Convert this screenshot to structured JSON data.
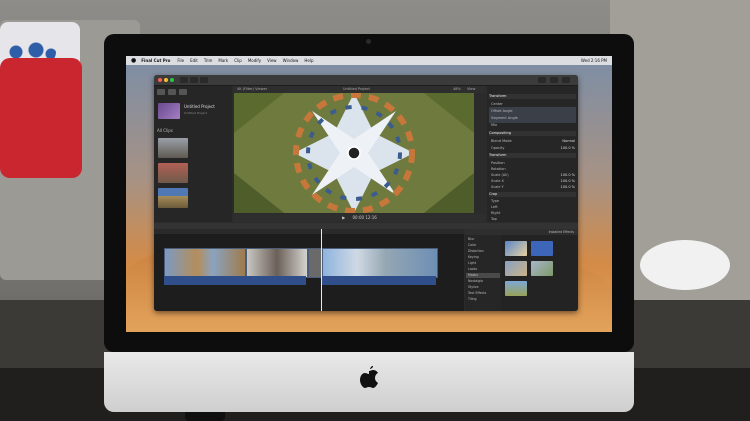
{
  "menubar": {
    "app_name": "Final Cut Pro",
    "items": [
      "File",
      "Edit",
      "Trim",
      "Mark",
      "Clip",
      "Modify",
      "View",
      "Window",
      "Help"
    ],
    "clock": "Wed 2:16 PM"
  },
  "window": {
    "viewer_title": "4K (Filter) Viewer",
    "viewer_clip": "Untitled Project",
    "zoom": "48%",
    "view_menu": "View",
    "timecode": "00:00 12:16"
  },
  "browser": {
    "library_name": "Untitled Project",
    "library_note": "Untitled Project",
    "event_label": "All Clips",
    "thumbs": [
      "",
      "",
      ""
    ]
  },
  "inspector": {
    "sections": [
      "Transform",
      "Compositing",
      "Transform",
      "Crop"
    ],
    "rows": [
      {
        "label": "Center",
        "val": ""
      },
      {
        "label": "Offset Angle",
        "val": ""
      },
      {
        "label": "Segment Angle",
        "val": ""
      },
      {
        "label": "Mix",
        "val": ""
      },
      {
        "label": "Blend Mode",
        "val": "Normal"
      },
      {
        "label": "Opacity",
        "val": "100.0 %"
      },
      {
        "label": "Position",
        "val": ""
      },
      {
        "label": "Rotation",
        "val": ""
      },
      {
        "label": "Scale (All)",
        "val": "100.0 %"
      },
      {
        "label": "Scale X",
        "val": "100.0 %"
      },
      {
        "label": "Scale Y",
        "val": "100.0 %"
      },
      {
        "label": "Anchor",
        "val": ""
      },
      {
        "label": "Type",
        "val": ""
      },
      {
        "label": "Left",
        "val": ""
      },
      {
        "label": "Right",
        "val": ""
      },
      {
        "label": "Top",
        "val": ""
      },
      {
        "label": "Bottom",
        "val": ""
      }
    ],
    "save_button": ""
  },
  "effects": {
    "header": "Installed Effects",
    "categories": [
      "Blur",
      "Color",
      "Distortion",
      "Keying",
      "Light",
      "Looks",
      "Masks",
      "Nostalgia",
      "Stylize",
      "Text Effects",
      "Tiling"
    ]
  },
  "apple_logo_glyph": ""
}
